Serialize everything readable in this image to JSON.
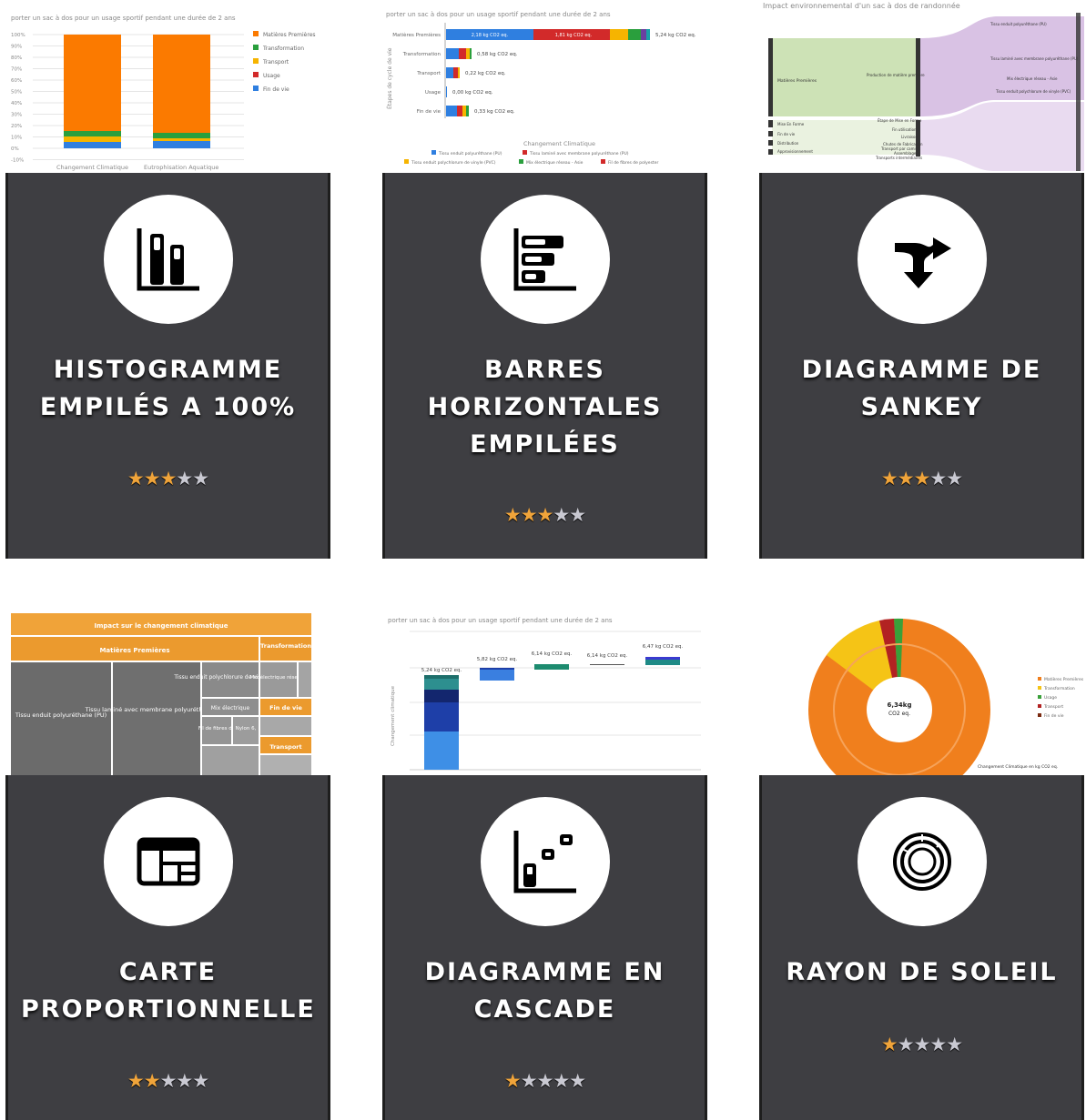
{
  "cards": [
    {
      "title_lines": [
        "HISTOGRAMME",
        "EMPILÉS A 100%"
      ],
      "rating": 3,
      "max_rating": 5,
      "icon": "stacked-column-chart-icon",
      "preview": {
        "subtitle": "porter un sac à dos pour un usage sportif pendant une durée de 2 ans",
        "y_ticks": [
          "100%",
          "90%",
          "80%",
          "70%",
          "60%",
          "50%",
          "40%",
          "30%",
          "20%",
          "10%",
          "0%",
          "-10%"
        ],
        "categories": [
          "Changement Climatique",
          "Eutrophisation Aquatique"
        ],
        "legend": [
          "Matières Premières",
          "Transformation",
          "Transport",
          "Usage",
          "Fin de vie"
        ],
        "colors": [
          "#fb7a00",
          "#2a9f3d",
          "#f6b400",
          "#d22a2a",
          "#2f7fe0"
        ]
      }
    },
    {
      "title_lines": [
        "BARRES",
        "HORIZONTALES",
        "EMPILÉES"
      ],
      "rating": 3,
      "max_rating": 5,
      "icon": "stacked-bar-chart-icon",
      "preview": {
        "subtitle": "porter un sac à dos pour un usage sportif pendant une durée de 2 ans",
        "y_axis_label": "Étapes de cycle de vie",
        "rows": [
          "Matières Premières",
          "Transformation",
          "Transport",
          "Usage",
          "Fin de vie"
        ],
        "values": [
          "5,24 kg CO2 eq.",
          "0,58 kg CO2 eq.",
          "0,22 kg CO2 eq.",
          "0,00 kg CO2 eq.",
          "0,33 kg CO2 eq."
        ],
        "seg1": "2,18 kg CO2 eq.",
        "seg2": "1,81 kg CO2 eq.",
        "x_axis_label": "Changement Climatique",
        "legend": [
          "Tissu enduit polyuréthane (PU)",
          "Tissu laminé avec membrane polyuréthane (PU)",
          "Tissu enduit polychlorure de vinyle (PVC)",
          "Mix électrique réseau - Asie",
          "Fil de fibres de polyester"
        ]
      }
    },
    {
      "title_lines": [
        "DIAGRAMME DE",
        "SANKEY"
      ],
      "rating": 3,
      "max_rating": 5,
      "icon": "sankey-arrow-icon",
      "preview": {
        "subtitle": "Impact environnemental d'un sac à dos de randonnée",
        "left_nodes": [
          "Matières Premières",
          "Mise En Forme",
          "Fin de vie",
          "Distribution",
          "Approvisionnement"
        ],
        "middle_nodes": [
          "Production de matière première",
          "Étape de Mise en Forme",
          "Fin utilisation",
          "Livraison",
          "Chutes de Fabrication",
          "Transport par camion",
          "Assemblage",
          "Transports intermédiaires"
        ],
        "right_nodes": [
          "Tissu enduit polyuréthane (PU)",
          "Tissu laminé avec membrane polyuréthane (PU)",
          "Mix électrique réseau - Asie",
          "Tissu enduit polychlorure de vinyle (PVC)"
        ]
      }
    },
    {
      "title_lines": [
        "CARTE",
        "PROPORTIONNELLE"
      ],
      "rating": 2,
      "max_rating": 5,
      "icon": "treemap-icon",
      "preview": {
        "header": "Impact sur le changement climatique",
        "main": "Matières Premières",
        "side": "Transformation",
        "cells": [
          "Tissu enduit polyuréthane (PU)",
          "Tissu laminé avec membrane polyuréthane (PU)",
          "Tissu enduit polychlorure de vinyle (PVC)",
          "Mix électrique réseau -",
          "Mix électrique",
          "Fil de fibres de",
          "Nylon 6,",
          "Fin de vie",
          "Transport"
        ]
      }
    },
    {
      "title_lines": [
        "DIAGRAMME EN",
        "CASCADE"
      ],
      "rating": 1,
      "max_rating": 5,
      "icon": "waterfall-chart-icon",
      "preview": {
        "subtitle": "porter un sac à dos pour un usage sportif pendant une durée de 2 ans",
        "y_axis_label": "Changement climatique",
        "labels": [
          "5,24 kg CO2 eq.",
          "5,82 kg CO2 eq.",
          "6,14 kg CO2 eq.",
          "6,14 kg CO2 eq.",
          "6,47 kg CO2 eq."
        ]
      }
    },
    {
      "title_lines": [
        "RAYON DE SOLEIL"
      ],
      "rating": 1,
      "max_rating": 5,
      "icon": "sunburst-icon",
      "preview": {
        "center_value": "6,34kg",
        "center_unit": "CO2 eq.",
        "caption": "Changement Climatique en kg CO2 eq.",
        "legend": [
          "Matières Premières",
          "Transformation",
          "Usage",
          "Transport",
          "Fin de vie"
        ],
        "colors": [
          "#f07f1d",
          "#f5c416",
          "#3aa03a",
          "#b22222",
          "#7a2a10"
        ]
      }
    }
  ]
}
